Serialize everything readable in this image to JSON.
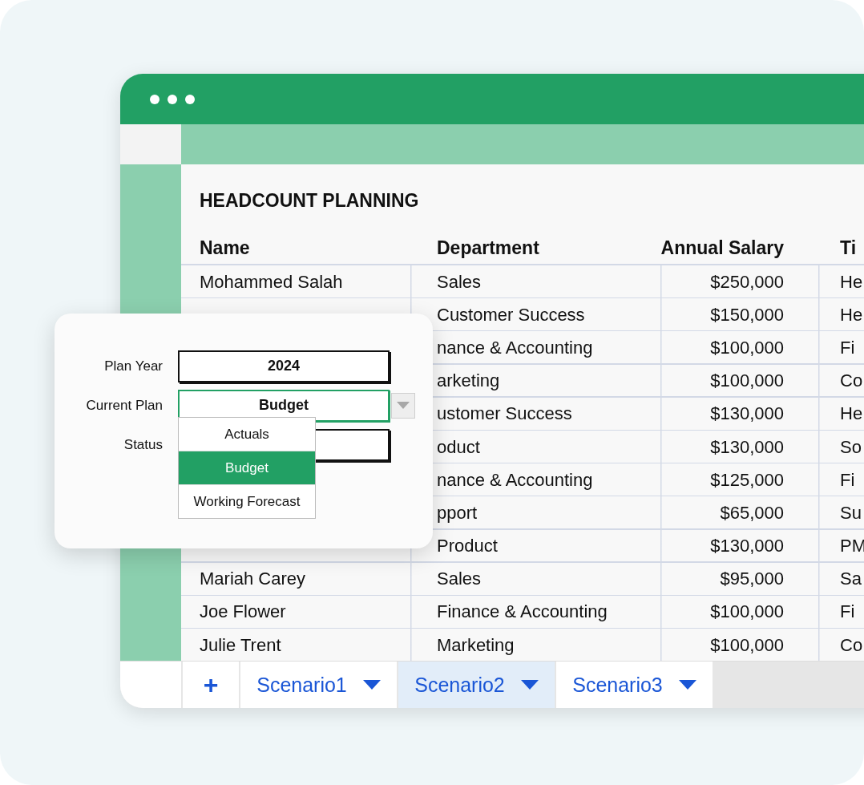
{
  "sheet": {
    "title": "HEADCOUNT PLANNING",
    "columns": [
      "Name",
      "Department",
      "Annual Salary",
      "Ti"
    ],
    "rows": [
      {
        "name": "Mohammed Salah",
        "department": "Sales",
        "salary": "$250,000",
        "title": "He"
      },
      {
        "department": "Customer Success",
        "salary": "$150,000",
        "title": "He"
      },
      {
        "department": "nance & Accounting",
        "salary": "$100,000",
        "title": "Fi"
      },
      {
        "department": "arketing",
        "salary": "$100,000",
        "title": "Co"
      },
      {
        "department": "ustomer Success",
        "salary": "$130,000",
        "title": "He"
      },
      {
        "department": "oduct",
        "salary": "$130,000",
        "title": "So"
      },
      {
        "department": "nance & Accounting",
        "salary": "$125,000",
        "title": "Fi"
      },
      {
        "department": "pport",
        "salary": "$65,000",
        "title": "Su"
      },
      {
        "department": "Product",
        "salary": "$130,000",
        "title": "PM"
      },
      {
        "name": "Mariah Carey",
        "department": "Sales",
        "salary": "$95,000",
        "title": "Sa"
      },
      {
        "name": "Joe Flower",
        "department": "Finance & Accounting",
        "salary": "$100,000",
        "title": "Fi"
      },
      {
        "name": "Julie Trent",
        "department": "Marketing",
        "salary": "$100,000",
        "title": "Co"
      }
    ]
  },
  "add_tab": {
    "label": "+"
  },
  "tabs": [
    {
      "label": "Scenario1",
      "selected": false
    },
    {
      "label": "Scenario2",
      "selected": true
    },
    {
      "label": "Scenario3",
      "selected": false
    }
  ],
  "form": {
    "fields": [
      {
        "label": "Plan Year",
        "kind": "text",
        "value": "2024",
        "focused": false
      },
      {
        "label": "Current Plan",
        "kind": "select",
        "value": "Budget",
        "focused": true
      },
      {
        "label": "Status",
        "kind": "text",
        "focused": false
      }
    ],
    "dropdown": {
      "options": [
        {
          "label": "Actuals",
          "selected": false
        },
        {
          "label": "Budget",
          "selected": true
        },
        {
          "label": "Working Forecast",
          "selected": false
        }
      ]
    }
  }
}
